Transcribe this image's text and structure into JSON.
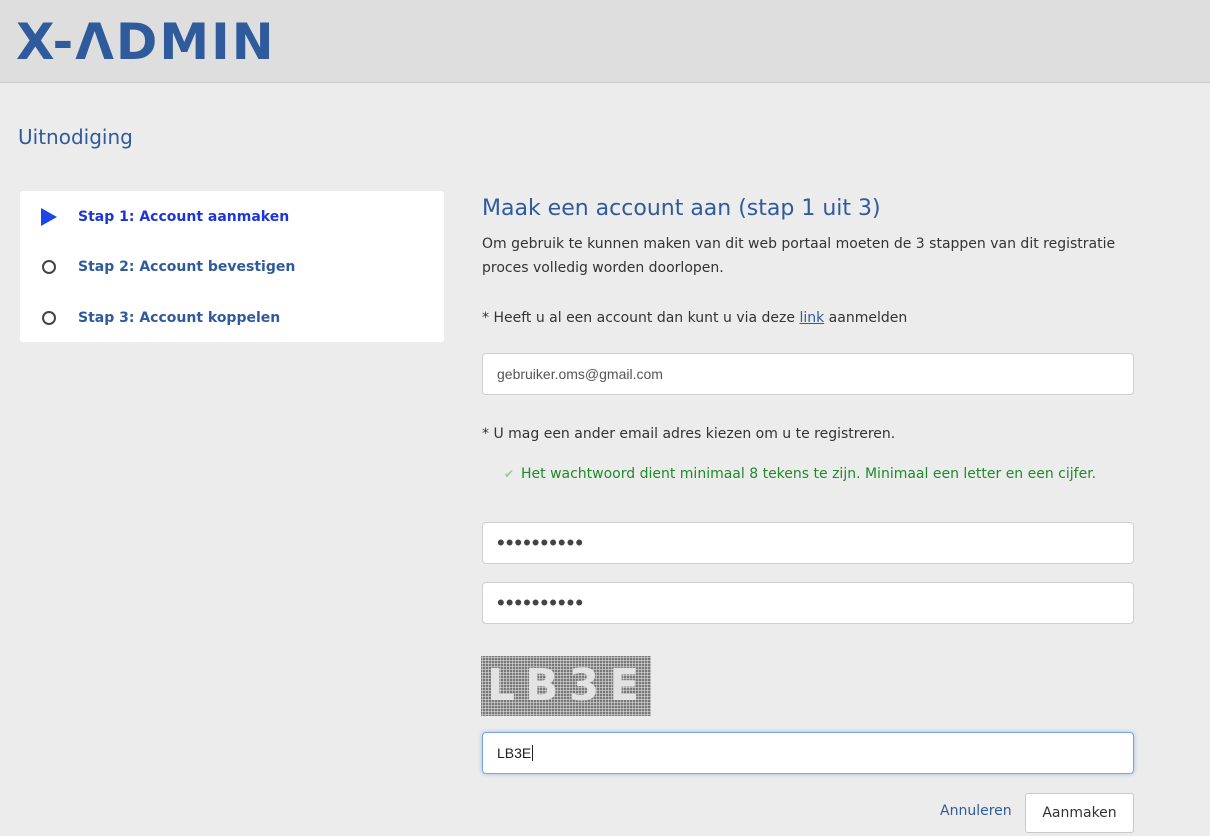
{
  "app": {
    "logo": "X-ΛDMIN"
  },
  "page": {
    "title": "Uitnodiging"
  },
  "steps": [
    {
      "label": "Stap 1: Account aanmaken",
      "state": "active",
      "icon": "play-triangle-icon"
    },
    {
      "label": "Stap 2: Account bevestigen",
      "state": "pending",
      "icon": "circle-icon"
    },
    {
      "label": "Stap 3: Account koppelen",
      "state": "pending",
      "icon": "circle-icon"
    }
  ],
  "form": {
    "title": "Maak een account aan (stap 1 uit 3)",
    "intro": "Om gebruik te kunnen maken van dit web portaal moeten de 3 stappen van dit registratie proces volledig worden doorlopen.",
    "login_hint_prefix": "* Heeft u al een account dan kunt u via deze",
    "login_hint_link": "link",
    "login_hint_suffix": "aanmelden",
    "email_value": "gebruiker.oms@gmail.com",
    "email_hint": "* U mag een ander email adres kiezen om u te registreren.",
    "password_note": "Het wachtwoord dient minimaal 8 tekens te zijn. Minimaal een letter en een cijfer.",
    "password_value": "••••••••••",
    "password_confirm_value": "••••••••••",
    "captcha_text": "LB3E",
    "captcha_input_value": "LB3E",
    "cancel_label": "Annuleren",
    "submit_label": "Aanmaken"
  },
  "colors": {
    "brand": "#2f5b9c",
    "active_step": "#1d46e8",
    "success": "#1f8a2a"
  }
}
